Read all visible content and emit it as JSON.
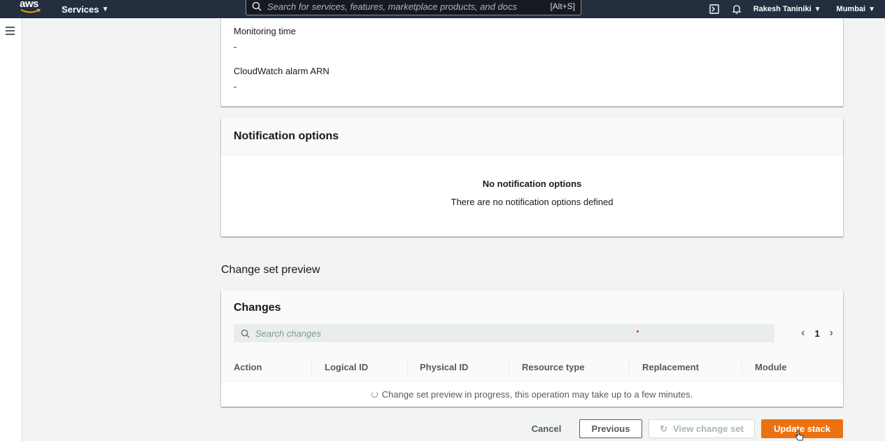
{
  "topnav": {
    "logo_text": "aws",
    "services_label": "Services",
    "search_placeholder": "Search for services, features, marketplace products, and docs",
    "search_shortcut": "[Alt+S]",
    "user_label": "Rakesh Taniniki",
    "region_label": "Mumbai"
  },
  "monitoring": {
    "fields": [
      {
        "label": "Monitoring time",
        "value": "-"
      },
      {
        "label": "CloudWatch alarm ARN",
        "value": "-"
      }
    ]
  },
  "notifications": {
    "title": "Notification options",
    "empty_title": "No notification options",
    "empty_desc": "There are no notification options defined"
  },
  "change_set": {
    "section_title": "Change set preview",
    "card_title": "Changes",
    "search_placeholder": "Search changes",
    "page_number": "1",
    "columns": [
      "Action",
      "Logical ID",
      "Physical ID",
      "Resource type",
      "Replacement",
      "Module"
    ],
    "progress_text": "Change set preview in progress, this operation may take up to a few minutes."
  },
  "footer": {
    "cancel": "Cancel",
    "previous": "Previous",
    "view_change_set": "View change set",
    "update_stack": "Update stack"
  },
  "colors": {
    "nav_bg": "#232f3e",
    "primary_button": "#ec7211"
  }
}
